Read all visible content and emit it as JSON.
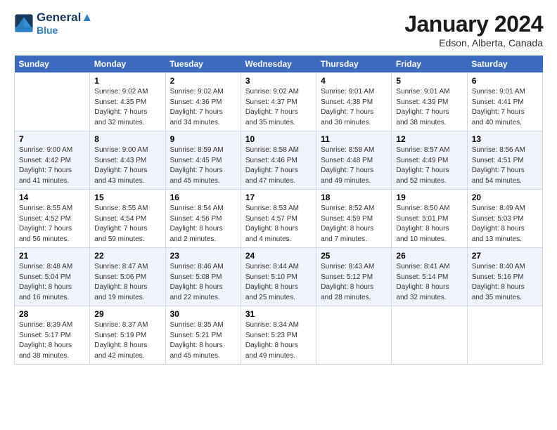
{
  "header": {
    "logo_line1": "General",
    "logo_line2": "Blue",
    "month": "January 2024",
    "location": "Edson, Alberta, Canada"
  },
  "days_of_week": [
    "Sunday",
    "Monday",
    "Tuesday",
    "Wednesday",
    "Thursday",
    "Friday",
    "Saturday"
  ],
  "weeks": [
    [
      {
        "day": "",
        "sunrise": "",
        "sunset": "",
        "daylight": ""
      },
      {
        "day": "1",
        "sunrise": "Sunrise: 9:02 AM",
        "sunset": "Sunset: 4:35 PM",
        "daylight": "Daylight: 7 hours and 32 minutes."
      },
      {
        "day": "2",
        "sunrise": "Sunrise: 9:02 AM",
        "sunset": "Sunset: 4:36 PM",
        "daylight": "Daylight: 7 hours and 34 minutes."
      },
      {
        "day": "3",
        "sunrise": "Sunrise: 9:02 AM",
        "sunset": "Sunset: 4:37 PM",
        "daylight": "Daylight: 7 hours and 35 minutes."
      },
      {
        "day": "4",
        "sunrise": "Sunrise: 9:01 AM",
        "sunset": "Sunset: 4:38 PM",
        "daylight": "Daylight: 7 hours and 36 minutes."
      },
      {
        "day": "5",
        "sunrise": "Sunrise: 9:01 AM",
        "sunset": "Sunset: 4:39 PM",
        "daylight": "Daylight: 7 hours and 38 minutes."
      },
      {
        "day": "6",
        "sunrise": "Sunrise: 9:01 AM",
        "sunset": "Sunset: 4:41 PM",
        "daylight": "Daylight: 7 hours and 40 minutes."
      }
    ],
    [
      {
        "day": "7",
        "sunrise": "Sunrise: 9:00 AM",
        "sunset": "Sunset: 4:42 PM",
        "daylight": "Daylight: 7 hours and 41 minutes."
      },
      {
        "day": "8",
        "sunrise": "Sunrise: 9:00 AM",
        "sunset": "Sunset: 4:43 PM",
        "daylight": "Daylight: 7 hours and 43 minutes."
      },
      {
        "day": "9",
        "sunrise": "Sunrise: 8:59 AM",
        "sunset": "Sunset: 4:45 PM",
        "daylight": "Daylight: 7 hours and 45 minutes."
      },
      {
        "day": "10",
        "sunrise": "Sunrise: 8:58 AM",
        "sunset": "Sunset: 4:46 PM",
        "daylight": "Daylight: 7 hours and 47 minutes."
      },
      {
        "day": "11",
        "sunrise": "Sunrise: 8:58 AM",
        "sunset": "Sunset: 4:48 PM",
        "daylight": "Daylight: 7 hours and 49 minutes."
      },
      {
        "day": "12",
        "sunrise": "Sunrise: 8:57 AM",
        "sunset": "Sunset: 4:49 PM",
        "daylight": "Daylight: 7 hours and 52 minutes."
      },
      {
        "day": "13",
        "sunrise": "Sunrise: 8:56 AM",
        "sunset": "Sunset: 4:51 PM",
        "daylight": "Daylight: 7 hours and 54 minutes."
      }
    ],
    [
      {
        "day": "14",
        "sunrise": "Sunrise: 8:55 AM",
        "sunset": "Sunset: 4:52 PM",
        "daylight": "Daylight: 7 hours and 56 minutes."
      },
      {
        "day": "15",
        "sunrise": "Sunrise: 8:55 AM",
        "sunset": "Sunset: 4:54 PM",
        "daylight": "Daylight: 7 hours and 59 minutes."
      },
      {
        "day": "16",
        "sunrise": "Sunrise: 8:54 AM",
        "sunset": "Sunset: 4:56 PM",
        "daylight": "Daylight: 8 hours and 2 minutes."
      },
      {
        "day": "17",
        "sunrise": "Sunrise: 8:53 AM",
        "sunset": "Sunset: 4:57 PM",
        "daylight": "Daylight: 8 hours and 4 minutes."
      },
      {
        "day": "18",
        "sunrise": "Sunrise: 8:52 AM",
        "sunset": "Sunset: 4:59 PM",
        "daylight": "Daylight: 8 hours and 7 minutes."
      },
      {
        "day": "19",
        "sunrise": "Sunrise: 8:50 AM",
        "sunset": "Sunset: 5:01 PM",
        "daylight": "Daylight: 8 hours and 10 minutes."
      },
      {
        "day": "20",
        "sunrise": "Sunrise: 8:49 AM",
        "sunset": "Sunset: 5:03 PM",
        "daylight": "Daylight: 8 hours and 13 minutes."
      }
    ],
    [
      {
        "day": "21",
        "sunrise": "Sunrise: 8:48 AM",
        "sunset": "Sunset: 5:04 PM",
        "daylight": "Daylight: 8 hours and 16 minutes."
      },
      {
        "day": "22",
        "sunrise": "Sunrise: 8:47 AM",
        "sunset": "Sunset: 5:06 PM",
        "daylight": "Daylight: 8 hours and 19 minutes."
      },
      {
        "day": "23",
        "sunrise": "Sunrise: 8:46 AM",
        "sunset": "Sunset: 5:08 PM",
        "daylight": "Daylight: 8 hours and 22 minutes."
      },
      {
        "day": "24",
        "sunrise": "Sunrise: 8:44 AM",
        "sunset": "Sunset: 5:10 PM",
        "daylight": "Daylight: 8 hours and 25 minutes."
      },
      {
        "day": "25",
        "sunrise": "Sunrise: 8:43 AM",
        "sunset": "Sunset: 5:12 PM",
        "daylight": "Daylight: 8 hours and 28 minutes."
      },
      {
        "day": "26",
        "sunrise": "Sunrise: 8:41 AM",
        "sunset": "Sunset: 5:14 PM",
        "daylight": "Daylight: 8 hours and 32 minutes."
      },
      {
        "day": "27",
        "sunrise": "Sunrise: 8:40 AM",
        "sunset": "Sunset: 5:16 PM",
        "daylight": "Daylight: 8 hours and 35 minutes."
      }
    ],
    [
      {
        "day": "28",
        "sunrise": "Sunrise: 8:39 AM",
        "sunset": "Sunset: 5:17 PM",
        "daylight": "Daylight: 8 hours and 38 minutes."
      },
      {
        "day": "29",
        "sunrise": "Sunrise: 8:37 AM",
        "sunset": "Sunset: 5:19 PM",
        "daylight": "Daylight: 8 hours and 42 minutes."
      },
      {
        "day": "30",
        "sunrise": "Sunrise: 8:35 AM",
        "sunset": "Sunset: 5:21 PM",
        "daylight": "Daylight: 8 hours and 45 minutes."
      },
      {
        "day": "31",
        "sunrise": "Sunrise: 8:34 AM",
        "sunset": "Sunset: 5:23 PM",
        "daylight": "Daylight: 8 hours and 49 minutes."
      },
      {
        "day": "",
        "sunrise": "",
        "sunset": "",
        "daylight": ""
      },
      {
        "day": "",
        "sunrise": "",
        "sunset": "",
        "daylight": ""
      },
      {
        "day": "",
        "sunrise": "",
        "sunset": "",
        "daylight": ""
      }
    ]
  ]
}
